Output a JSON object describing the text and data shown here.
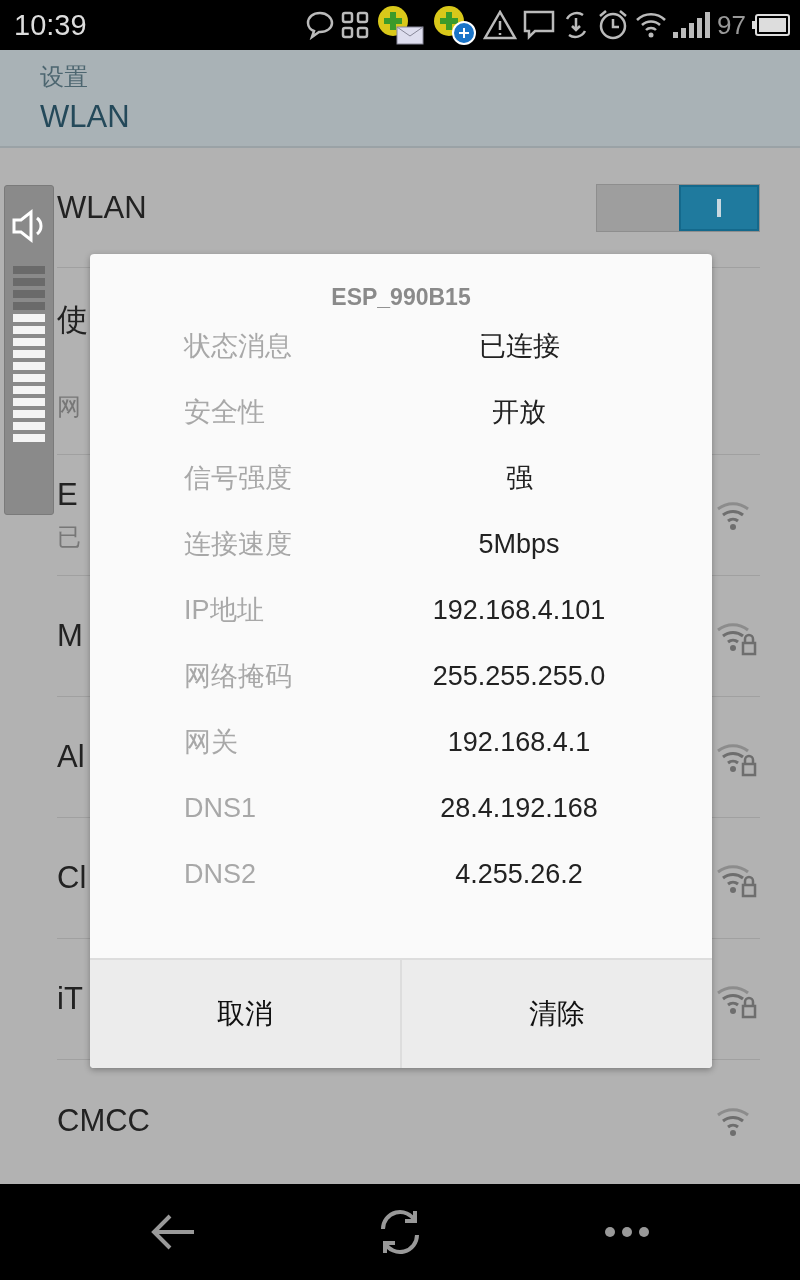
{
  "status_bar": {
    "time": "10:39",
    "battery": "97"
  },
  "header": {
    "parent": "设置",
    "title": "WLAN"
  },
  "wlan": {
    "label": "WLAN",
    "on": true
  },
  "rows": [
    {
      "title": "使",
      "subtitle": "网",
      "kind": "setting"
    },
    {
      "title": "E",
      "subtitle": "已",
      "kind": "network",
      "secured": false
    },
    {
      "title": "M",
      "kind": "network",
      "secured": true
    },
    {
      "title": "Al",
      "kind": "network",
      "secured": true
    },
    {
      "title": "Cl",
      "kind": "network",
      "secured": true
    },
    {
      "title": "iT",
      "kind": "network",
      "secured": true
    },
    {
      "title": "CMCC",
      "kind": "network",
      "secured": false
    }
  ],
  "volume": {
    "level": 0.73
  },
  "dialog": {
    "title": "ESP_990B15",
    "fields": [
      {
        "label": "状态消息",
        "value": "已连接"
      },
      {
        "label": "安全性",
        "value": "开放"
      },
      {
        "label": "信号强度",
        "value": "强"
      },
      {
        "label": "连接速度",
        "value": "5Mbps"
      },
      {
        "label": "IP地址",
        "value": "192.168.4.101"
      },
      {
        "label": "网络掩码",
        "value": "255.255.255.0"
      },
      {
        "label": "网关",
        "value": "192.168.4.1"
      },
      {
        "label": "DNS1",
        "value": "28.4.192.168"
      },
      {
        "label": "DNS2",
        "value": "4.255.26.2"
      }
    ],
    "buttons": [
      "取消",
      "清除"
    ]
  }
}
